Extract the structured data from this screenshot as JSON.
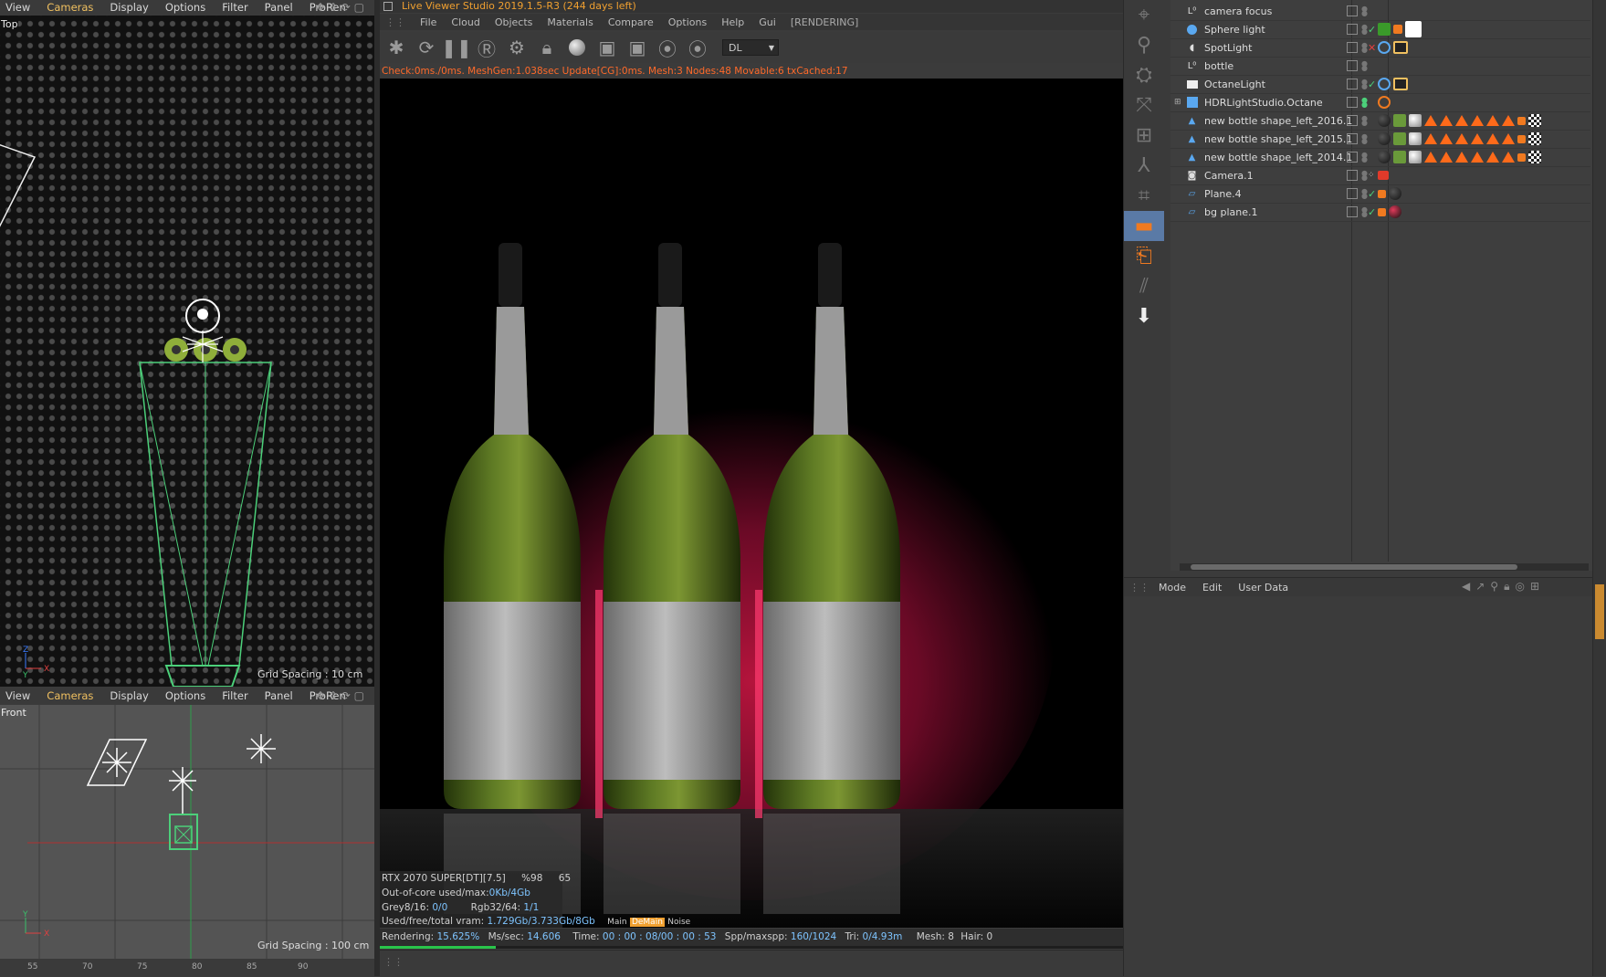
{
  "viewport_top": {
    "menu": [
      "View",
      "Cameras",
      "Display",
      "Options",
      "Filter",
      "Panel",
      "ProRen"
    ],
    "label": "Top",
    "grid_spacing": "Grid Spacing : 10 cm"
  },
  "viewport_front": {
    "menu": [
      "View",
      "Cameras",
      "Display",
      "Options",
      "Filter",
      "Panel",
      "ProRen"
    ],
    "label": "Front",
    "grid_spacing": "Grid Spacing : 100 cm",
    "ruler": [
      "55",
      "70",
      "75",
      "80",
      "85",
      "90"
    ]
  },
  "live_viewer": {
    "title": "Live Viewer Studio 2019.1.5-R3 (244 days left)",
    "menu": [
      "File",
      "Cloud",
      "Objects",
      "Materials",
      "Compare",
      "Options",
      "Help",
      "Gui"
    ],
    "state": "[RENDERING]",
    "mode_select": "DL",
    "stats_line": "Check:0ms./0ms. MeshGen:1.038sec Update[CG]:0ms. Mesh:3 Nodes:48 Movable:6 txCached:17",
    "gpu": "RTX 2070 SUPER[DT][7.5]",
    "gpu_load": "%98",
    "gpu_temp": "65",
    "ooc_label": "Out-of-core used/max:",
    "ooc_value": "0Kb/4Gb",
    "grey_label": "Grey8/16:",
    "grey_value": "0/0",
    "rgb_label": "Rgb32/64:",
    "rgb_value": "1/1",
    "vram_label": "Used/free/total vram:",
    "vram_value": "1.729Gb/3.733Gb/8Gb",
    "tabs": [
      "Main",
      "DeMain",
      "Noise"
    ],
    "rendering_label": "Rendering:",
    "rendering_value": "15.625%",
    "ms_label": "Ms/sec:",
    "ms_value": "14.606",
    "time_label": "Time:",
    "time_value": "00 : 00 : 08/00 : 00 : 53",
    "spp_label": "Spp/maxspp:",
    "spp_value": "160/1024",
    "tri_label": "Tri:",
    "tri_value": "0/4.93m",
    "mesh_label": "Mesh:",
    "mesh_value": "8",
    "hair_label": "Hair:",
    "hair_value": "0",
    "progress": 0.15625
  },
  "object_manager": {
    "objects": [
      {
        "name": "camera focus",
        "icon": "null-icon"
      },
      {
        "name": "Sphere light",
        "icon": "sphere-light-icon"
      },
      {
        "name": "SpotLight",
        "icon": "spotlight-icon"
      },
      {
        "name": "bottle",
        "icon": "null-icon"
      },
      {
        "name": "OctaneLight",
        "icon": "octane-light-icon"
      },
      {
        "name": "HDRLightStudio.Octane",
        "icon": "hdr-studio-icon"
      },
      {
        "name": "new bottle shape_left_2016.1",
        "icon": "mesh-icon"
      },
      {
        "name": "new bottle shape_left_2015.1",
        "icon": "mesh-icon"
      },
      {
        "name": "new bottle shape_left_2014.1",
        "icon": "mesh-icon"
      },
      {
        "name": "Camera.1",
        "icon": "camera-icon"
      },
      {
        "name": "Plane.4",
        "icon": "plane-icon"
      },
      {
        "name": "bg plane.1",
        "icon": "plane-icon"
      }
    ]
  },
  "attributes": {
    "menu": [
      "Mode",
      "Edit",
      "User Data"
    ]
  },
  "colors": {
    "accent_orange": "#f0a030",
    "stat_orange": "#ff6a2a",
    "value_blue": "#7ec4ff",
    "selection_green": "#4cd07a",
    "progress_green": "#29c44a"
  }
}
